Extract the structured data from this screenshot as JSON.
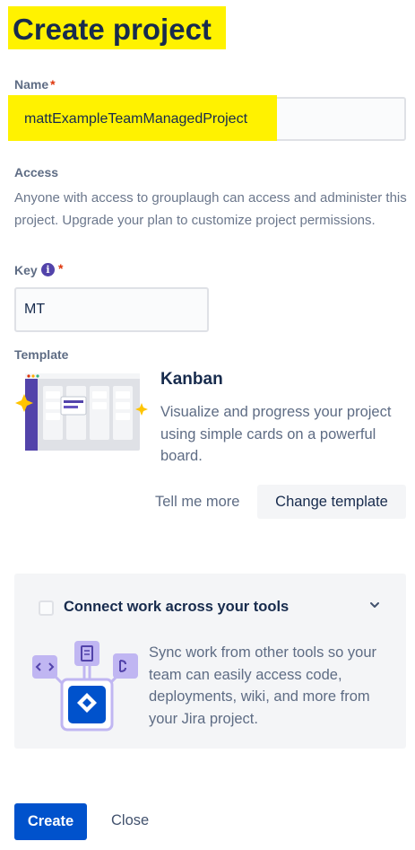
{
  "header": {
    "title": "Create project"
  },
  "form": {
    "name_label": "Name",
    "required_marker": "*",
    "name_value": "mattExampleTeamManagedProject",
    "access_label": "Access",
    "access_description": "Anyone with access to grouplaugh can access and administer this project. Upgrade your plan to customize project permissions.",
    "key_label": "Key",
    "key_value": "MT",
    "template_label": "Template"
  },
  "template": {
    "name": "Kanban",
    "description": "Visualize and progress your project using simple cards on a powerful board.",
    "tell_more": "Tell me more",
    "change_button": "Change template"
  },
  "connect": {
    "title": "Connect work across your tools",
    "description": "Sync work from other tools so your team can easily access code, deployments, wiki, and more from your Jira project.",
    "checked": false
  },
  "actions": {
    "create_label": "Create",
    "close_label": "Close"
  },
  "colors": {
    "highlight": "#fff200",
    "primary": "#0052cc",
    "info_icon": "#5243aa",
    "required": "#de350b"
  }
}
